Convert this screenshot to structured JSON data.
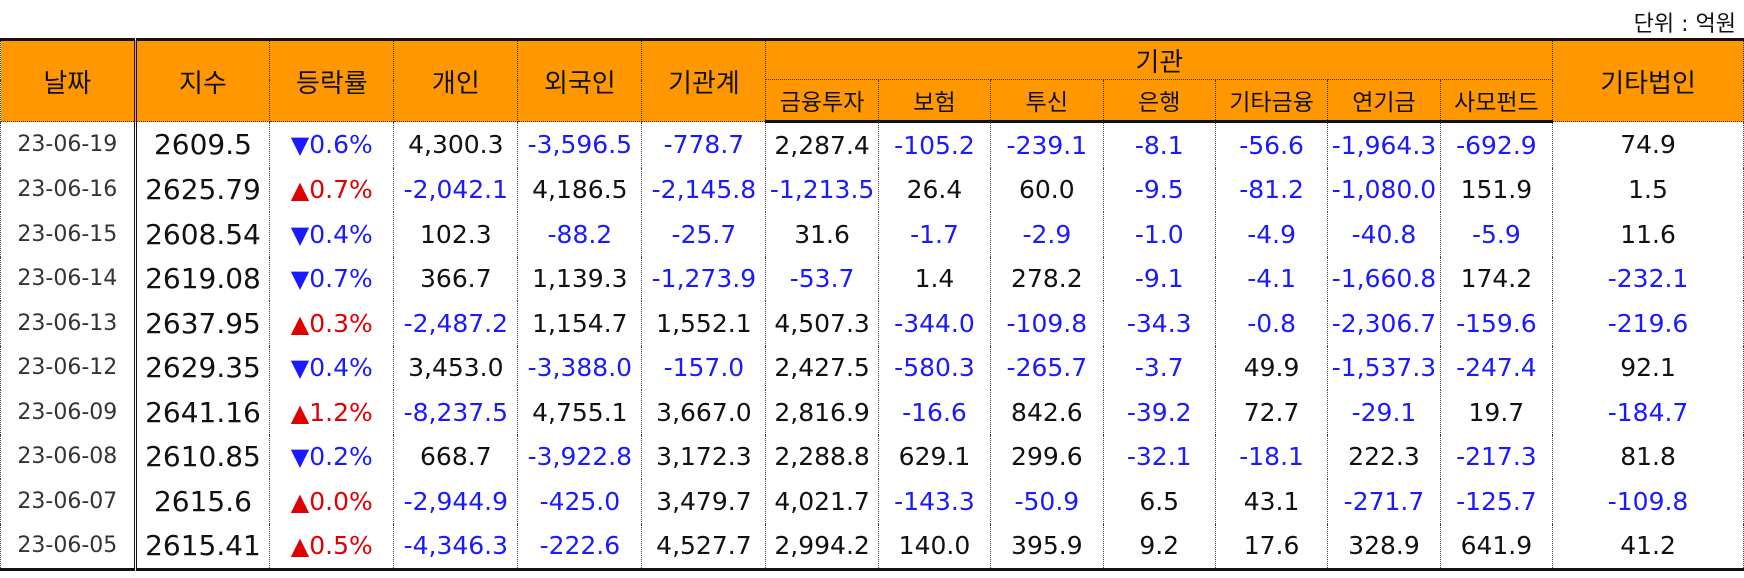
{
  "unit_label": "단위 : 억원",
  "headers": {
    "date": "날짜",
    "index": "지수",
    "change": "등락률",
    "individual": "개인",
    "foreign": "외국인",
    "inst_total": "기관계",
    "institution": "기관",
    "sub": [
      "금융투자",
      "보험",
      "투신",
      "은행",
      "기타금융",
      "연기금",
      "사모펀드"
    ],
    "other_corp": "기타법인"
  },
  "rows": [
    {
      "date": "23-06-19",
      "index": "2609.5",
      "dir": "down",
      "change": "0.6%",
      "vals": [
        "4,300.3",
        "-3,596.5",
        "-778.7",
        "2,287.4",
        "-105.2",
        "-239.1",
        "-8.1",
        "-56.6",
        "-1,964.3",
        "-692.9",
        "74.9"
      ]
    },
    {
      "date": "23-06-16",
      "index": "2625.79",
      "dir": "up",
      "change": "0.7%",
      "vals": [
        "-2,042.1",
        "4,186.5",
        "-2,145.8",
        "-1,213.5",
        "26.4",
        "60.0",
        "-9.5",
        "-81.2",
        "-1,080.0",
        "151.9",
        "1.5"
      ]
    },
    {
      "date": "23-06-15",
      "index": "2608.54",
      "dir": "down",
      "change": "0.4%",
      "vals": [
        "102.3",
        "-88.2",
        "-25.7",
        "31.6",
        "-1.7",
        "-2.9",
        "-1.0",
        "-4.9",
        "-40.8",
        "-5.9",
        "11.6"
      ]
    },
    {
      "date": "23-06-14",
      "index": "2619.08",
      "dir": "down",
      "change": "0.7%",
      "vals": [
        "366.7",
        "1,139.3",
        "-1,273.9",
        "-53.7",
        "1.4",
        "278.2",
        "-9.1",
        "-4.1",
        "-1,660.8",
        "174.2",
        "-232.1"
      ]
    },
    {
      "date": "23-06-13",
      "index": "2637.95",
      "dir": "up",
      "change": "0.3%",
      "vals": [
        "-2,487.2",
        "1,154.7",
        "1,552.1",
        "4,507.3",
        "-344.0",
        "-109.8",
        "-34.3",
        "-0.8",
        "-2,306.7",
        "-159.6",
        "-219.6"
      ]
    },
    {
      "date": "23-06-12",
      "index": "2629.35",
      "dir": "down",
      "change": "0.4%",
      "vals": [
        "3,453.0",
        "-3,388.0",
        "-157.0",
        "2,427.5",
        "-580.3",
        "-265.7",
        "-3.7",
        "49.9",
        "-1,537.3",
        "-247.4",
        "92.1"
      ]
    },
    {
      "date": "23-06-09",
      "index": "2641.16",
      "dir": "up",
      "change": "1.2%",
      "vals": [
        "-8,237.5",
        "4,755.1",
        "3,667.0",
        "2,816.9",
        "-16.6",
        "842.6",
        "-39.2",
        "72.7",
        "-29.1",
        "19.7",
        "-184.7"
      ]
    },
    {
      "date": "23-06-08",
      "index": "2610.85",
      "dir": "down",
      "change": "0.2%",
      "vals": [
        "668.7",
        "-3,922.8",
        "3,172.3",
        "2,288.8",
        "629.1",
        "299.6",
        "-32.1",
        "-18.1",
        "222.3",
        "-217.3",
        "81.8"
      ]
    },
    {
      "date": "23-06-07",
      "index": "2615.6",
      "dir": "up",
      "change": "0.0%",
      "vals": [
        "-2,944.9",
        "-425.0",
        "3,479.7",
        "4,021.7",
        "-143.3",
        "-50.9",
        "6.5",
        "43.1",
        "-271.7",
        "-125.7",
        "-109.8"
      ]
    },
    {
      "date": "23-06-05",
      "index": "2615.41",
      "dir": "up",
      "change": "0.5%",
      "vals": [
        "-4,346.3",
        "-222.6",
        "4,527.7",
        "2,994.2",
        "140.0",
        "395.9",
        "9.2",
        "17.6",
        "328.9",
        "641.9",
        "41.2"
      ]
    }
  ],
  "symbols": {
    "up": "▲",
    "down": "▼"
  },
  "colors": {
    "header_bg": "#ff9800",
    "negative": "#1a1aff",
    "up": "#e00000",
    "down": "#1a1aff"
  }
}
